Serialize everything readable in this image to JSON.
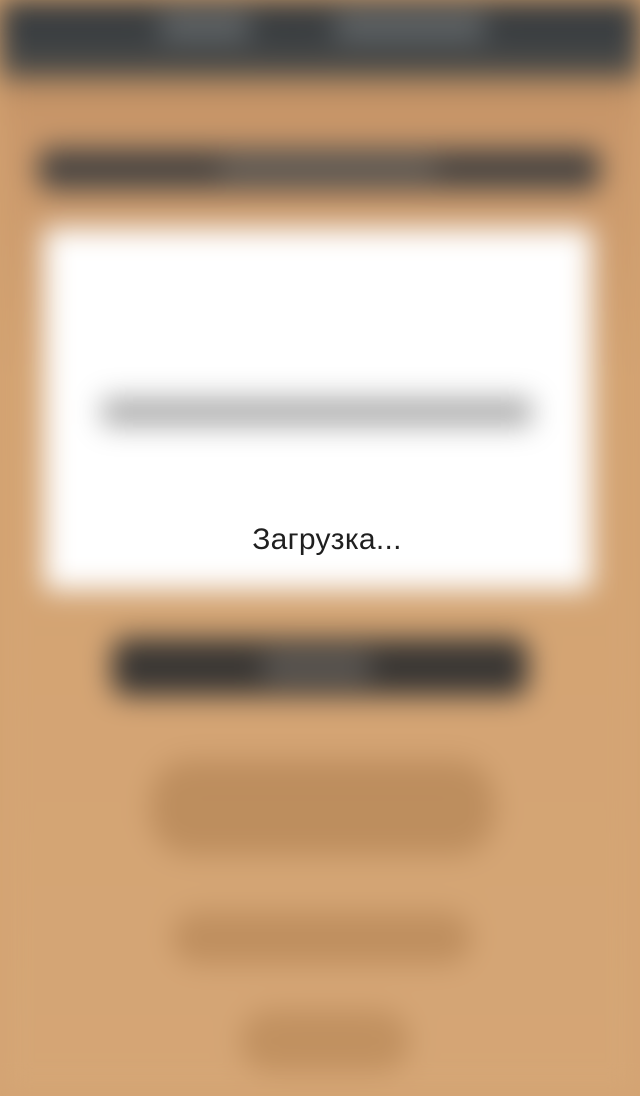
{
  "loading": {
    "text": "Загрузка..."
  }
}
